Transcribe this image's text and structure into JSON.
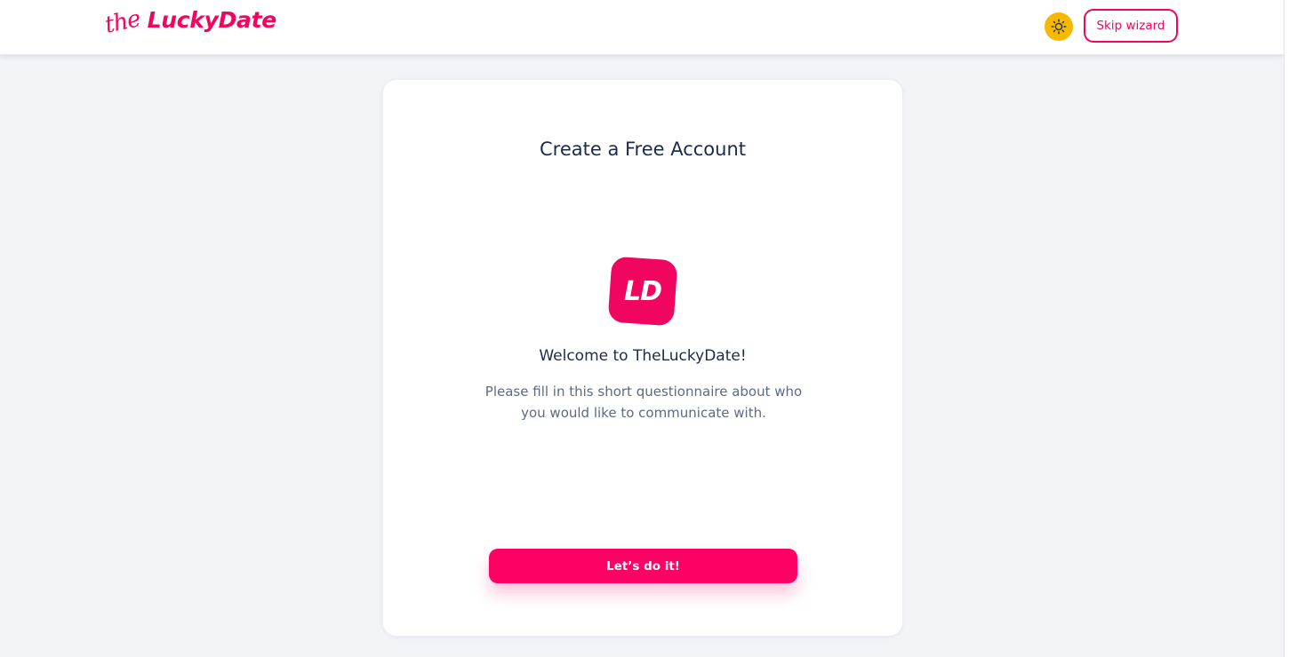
{
  "header": {
    "logo_prefix": "the",
    "logo_name": "LuckyDate",
    "theme_icon": "sun-icon",
    "skip_label": "Skip wizard"
  },
  "card": {
    "title": "Create a Free Account",
    "logo_text": "LD",
    "welcome": "Welcome to TheLuckyDate!",
    "description": "Please fill in this short questionnaire about who you would like to communicate with.",
    "cta_label": "Let’s do it!"
  },
  "colors": {
    "brand": "#f0065f",
    "cta": "#ff0064",
    "theme_toggle": "#f7b800",
    "background": "#f3f4f8"
  }
}
